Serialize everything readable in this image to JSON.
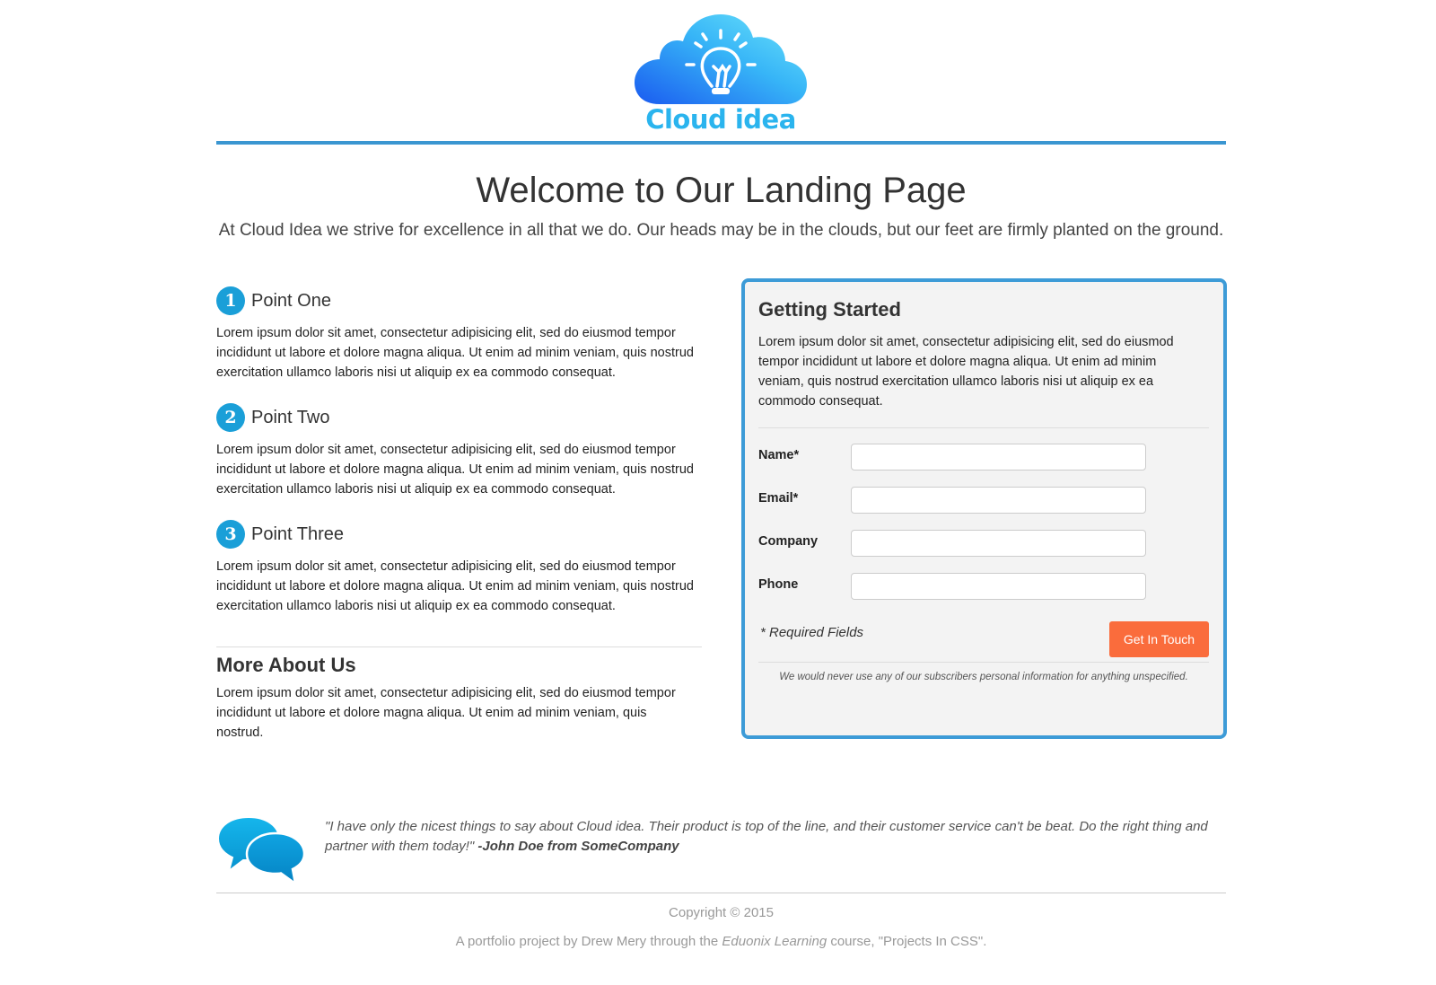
{
  "header": {
    "logo_text": "Cloud idea",
    "accent_color": "#3a96d1"
  },
  "intro": {
    "title": "Welcome to Our Landing Page",
    "subtitle": "At Cloud Idea we strive for excellence in all that we do. Our heads may be in the clouds, but our feet are firmly planted on the ground."
  },
  "points": [
    {
      "number": "1",
      "title": "Point One",
      "body": "Lorem ipsum dolor sit amet, consectetur adipisicing elit, sed do eiusmod tempor incididunt ut labore et dolore magna aliqua. Ut enim ad minim veniam, quis nostrud exercitation ullamco laboris nisi ut aliquip ex ea commodo consequat."
    },
    {
      "number": "2",
      "title": "Point Two",
      "body": "Lorem ipsum dolor sit amet, consectetur adipisicing elit, sed do eiusmod tempor incididunt ut labore et dolore magna aliqua. Ut enim ad minim veniam, quis nostrud exercitation ullamco laboris nisi ut aliquip ex ea commodo consequat."
    },
    {
      "number": "3",
      "title": "Point Three",
      "body": "Lorem ipsum dolor sit amet, consectetur adipisicing elit, sed do eiusmod tempor incididunt ut labore et dolore magna aliqua. Ut enim ad minim veniam, quis nostrud exercitation ullamco laboris nisi ut aliquip ex ea commodo consequat."
    }
  ],
  "more": {
    "title": "More About Us",
    "body": "Lorem ipsum dolor sit amet, consectetur adipisicing elit, sed do eiusmod tempor incididunt ut labore et dolore magna aliqua. Ut enim ad minim veniam, quis nostrud."
  },
  "form": {
    "title": "Getting Started",
    "description": "Lorem ipsum dolor sit amet, consectetur adipisicing elit, sed do eiusmod tempor incididunt ut labore et dolore magna aliqua. Ut enim ad minim veniam, quis nostrud exercitation ullamco laboris nisi ut aliquip ex ea commodo consequat.",
    "fields": [
      {
        "label": "Name*",
        "value": ""
      },
      {
        "label": "Email*",
        "value": ""
      },
      {
        "label": "Company",
        "value": ""
      },
      {
        "label": "Phone",
        "value": ""
      }
    ],
    "required_note": "* Required Fields",
    "submit_label": "Get In Touch",
    "submit_color": "#fa6c3c",
    "privacy_note": "We would never use any of our subscribers personal information for anything unspecified."
  },
  "testimonial": {
    "icon": "speech-bubbles-icon",
    "quote": "\"I have only the nicest things to say about Cloud idea. Their product is top of the line, and their customer service can't be beat. Do the right thing and partner with them today!\"",
    "author": "-John Doe from SomeCompany"
  },
  "footer": {
    "copyright": "Copyright © 2015",
    "credit_prefix": "A portfolio project by Drew Mery through the ",
    "credit_org": "Eduonix Learning",
    "credit_suffix": " course, \"Projects In CSS\"."
  }
}
